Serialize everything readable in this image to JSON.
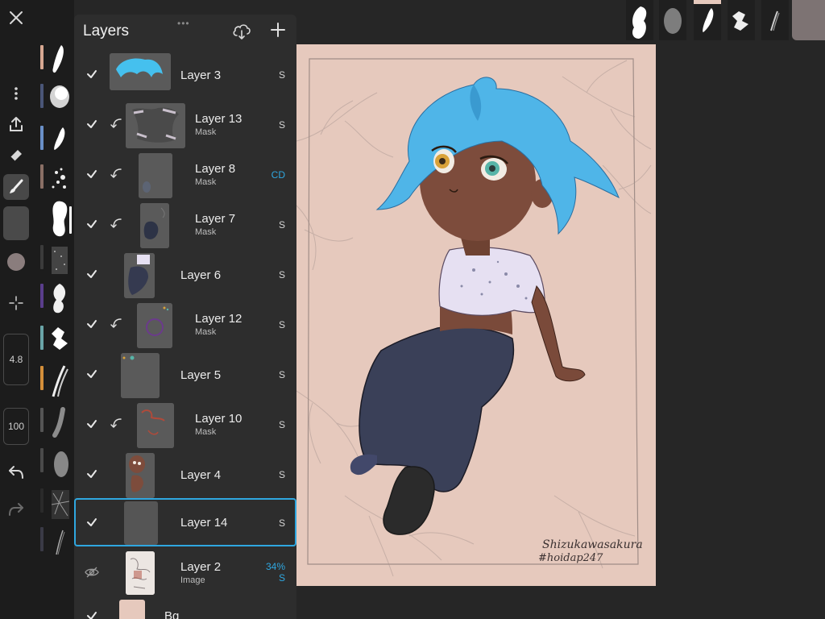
{
  "toolbar": {
    "size_value": "4.8",
    "opacity_value": "100"
  },
  "colors": {
    "accent": "#2fa7e0",
    "current_color": "#7d7373",
    "canvas_bg": "#e6c9bd"
  },
  "brush_strip": {
    "tag_colors": [
      "#d7a892",
      "#4a5678",
      "#6a90c8",
      "#8a6f65",
      "#ffffff",
      "#3b3b3b",
      "#5a3e8c",
      "#6aa5a8",
      "#d48f3a",
      "#555555",
      "#4a4a4a",
      "#2a2a2a",
      "#3a3a46"
    ]
  },
  "layers": {
    "title": "Layers",
    "items": [
      {
        "name": "Layer 3",
        "sub": "",
        "blend": "S",
        "visible": true,
        "clipped": false
      },
      {
        "name": "Layer 13",
        "sub": "Mask",
        "blend": "S",
        "visible": true,
        "clipped": true
      },
      {
        "name": "Layer 8",
        "sub": "Mask",
        "blend": "CD",
        "visible": true,
        "clipped": true
      },
      {
        "name": "Layer 7",
        "sub": "Mask",
        "blend": "S",
        "visible": true,
        "clipped": true
      },
      {
        "name": "Layer 6",
        "sub": "",
        "blend": "S",
        "visible": true,
        "clipped": false
      },
      {
        "name": "Layer 12",
        "sub": "Mask",
        "blend": "S",
        "visible": true,
        "clipped": true
      },
      {
        "name": "Layer 5",
        "sub": "",
        "blend": "S",
        "visible": true,
        "clipped": false
      },
      {
        "name": "Layer 10",
        "sub": "Mask",
        "blend": "S",
        "visible": true,
        "clipped": true
      },
      {
        "name": "Layer 4",
        "sub": "",
        "blend": "S",
        "visible": true,
        "clipped": false
      },
      {
        "name": "Layer 14",
        "sub": "",
        "blend": "S",
        "visible": true,
        "clipped": false,
        "selected": true
      },
      {
        "name": "Layer 2",
        "sub": "Image",
        "blend": "S",
        "opacity": "34%",
        "visible": false,
        "clipped": false
      },
      {
        "name": "Bg",
        "sub": "",
        "blend": "",
        "visible": true,
        "clipped": false
      }
    ]
  },
  "canvas": {
    "signature_line1": "Shizukawasakura",
    "signature_line2": "#hoidap247"
  }
}
